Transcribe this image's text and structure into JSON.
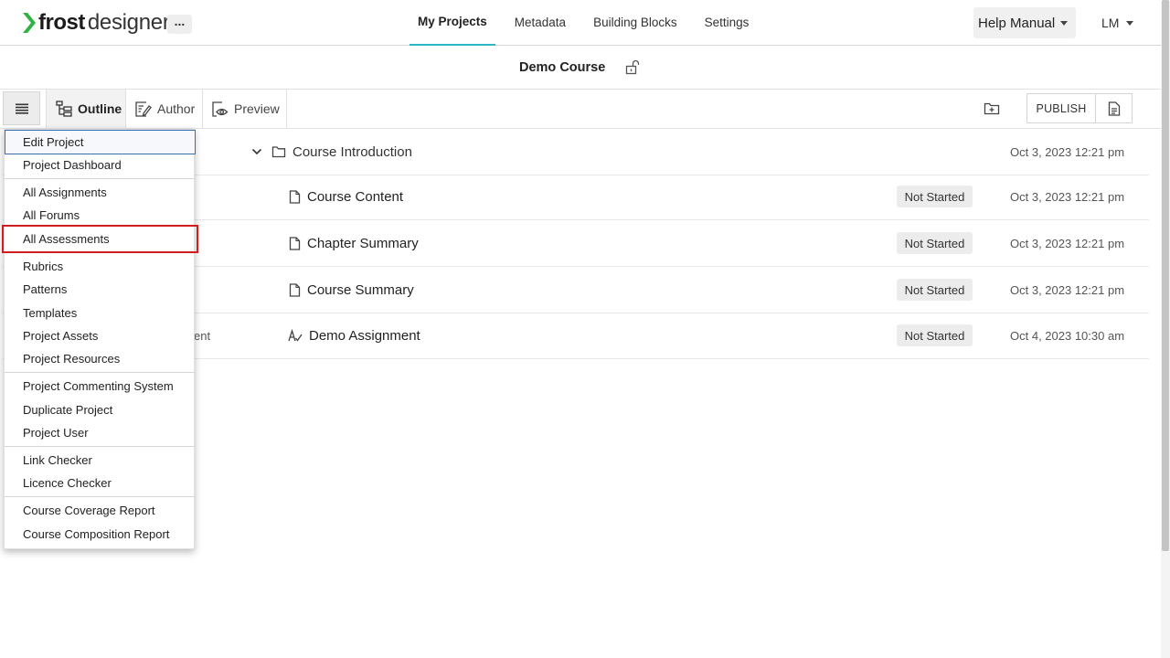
{
  "header": {
    "logo_brand": "frost",
    "logo_sub": "designer",
    "more_label": "...",
    "tabs": [
      {
        "label": "My Projects",
        "active": true
      },
      {
        "label": "Metadata",
        "active": false
      },
      {
        "label": "Building Blocks",
        "active": false
      },
      {
        "label": "Settings",
        "active": false
      }
    ],
    "help_label": "Help Manual",
    "user_initials": "LM",
    "accent_color": "#2bb5c6",
    "logo_color": "#2fb344"
  },
  "course": {
    "title": "Demo Course",
    "lock_icon": "unlock-icon"
  },
  "toolbar": {
    "outline_label": "Outline",
    "author_label": "Author",
    "preview_label": "Preview",
    "publish_label": "PUBLISH"
  },
  "outline": {
    "rows": [
      {
        "title": "Course Introduction",
        "icon": "folder-icon",
        "status": "",
        "date": "Oct 3, 2023 12:21 pm"
      },
      {
        "title": "Course Content",
        "icon": "page-icon",
        "status": "Not Started",
        "date": "Oct 3, 2023 12:21 pm"
      },
      {
        "title": "Chapter Summary",
        "icon": "page-icon",
        "status": "Not Started",
        "date": "Oct 3, 2023 12:21 pm"
      },
      {
        "title": "Course Summary",
        "icon": "page-icon",
        "status": "Not Started",
        "date": "Oct 3, 2023 12:21 pm"
      },
      {
        "title": "Demo Assignment",
        "icon": "assignment-icon",
        "status": "Not Started",
        "date": "Oct 4, 2023 10:30 am",
        "partial_left_text": "ent"
      }
    ]
  },
  "menu": {
    "items": [
      "Edit Project",
      "Project Dashboard",
      "All Assignments",
      "All Forums",
      "All Assessments",
      "Rubrics",
      "Patterns",
      "Templates",
      "Project Assets",
      "Project Resources",
      "Project Commenting System",
      "Duplicate Project",
      "Project User",
      "Link Checker",
      "Licence Checker",
      "Course Coverage Report",
      "Course Composition Report"
    ],
    "highlight_color": "#d01e1e"
  }
}
